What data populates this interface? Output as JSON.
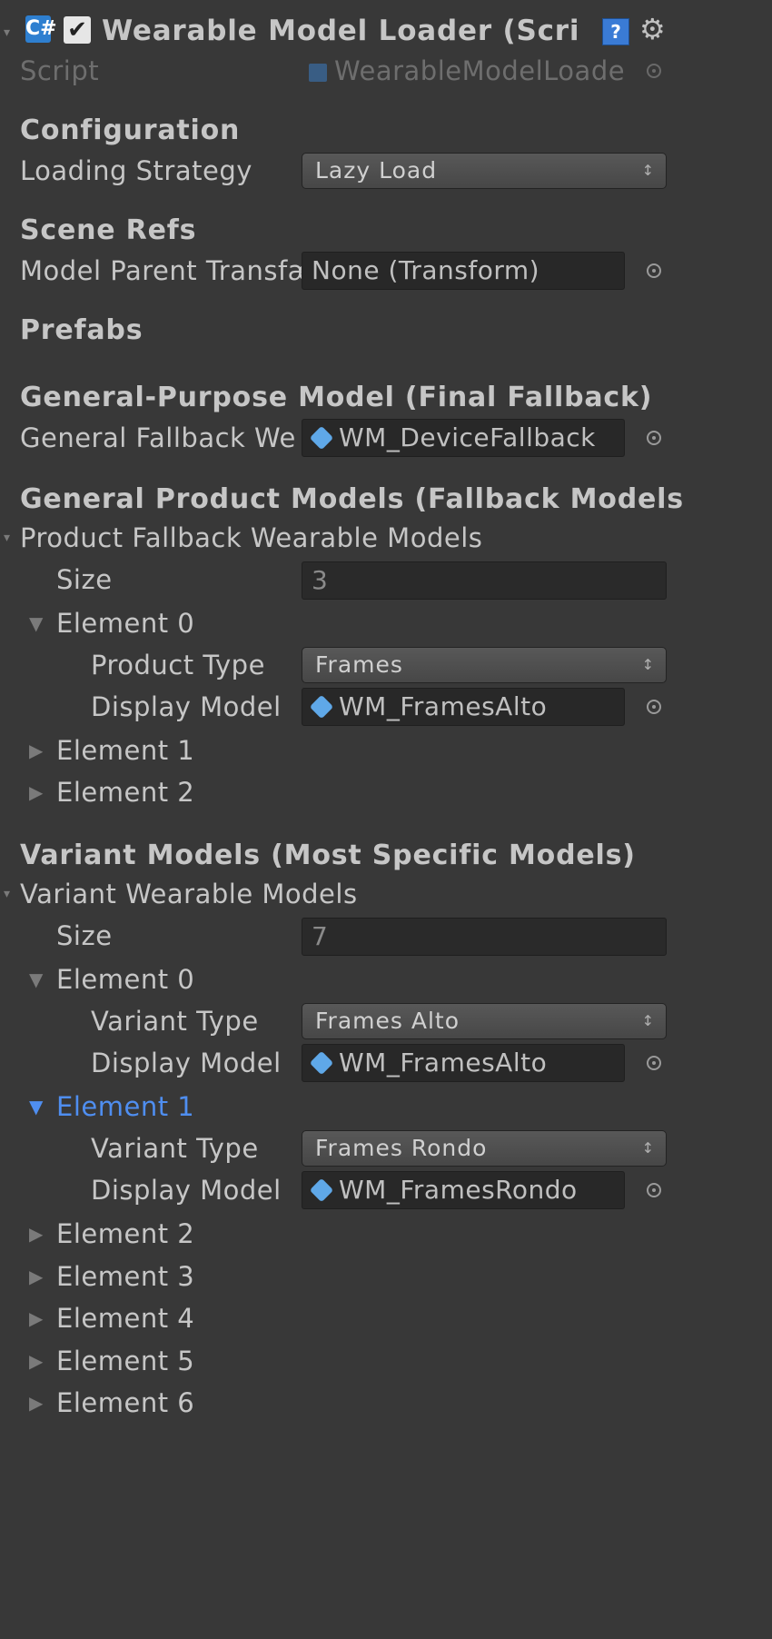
{
  "header": {
    "title": "Wearable Model Loader (Scri",
    "enabled": true,
    "script_label": "Script",
    "script_value": "WearableModelLoade"
  },
  "configuration": {
    "heading": "Configuration",
    "loading_strategy_label": "Loading Strategy",
    "loading_strategy_value": "Lazy Load"
  },
  "scene_refs": {
    "heading": "Scene Refs",
    "model_parent_label": "Model Parent Transfæ",
    "model_parent_value": "None (Transform)"
  },
  "prefabs": {
    "heading": "Prefabs"
  },
  "general_purpose": {
    "heading": "General-Purpose Model (Final Fallback)",
    "label": "General Fallback We",
    "value": "WM_DeviceFallback"
  },
  "product_models": {
    "heading": "General Product Models (Fallback Models",
    "list_label": "Product Fallback Wearable Models",
    "size_label": "Size",
    "size_value": "3",
    "elements": [
      {
        "label": "Element 0",
        "expanded": true,
        "type_label": "Product Type",
        "type_value": "Frames",
        "model_label": "Display Model",
        "model_value": "WM_FramesAlto"
      },
      {
        "label": "Element 1",
        "expanded": false
      },
      {
        "label": "Element 2",
        "expanded": false
      }
    ]
  },
  "variant_models": {
    "heading": "Variant Models (Most Specific Models)",
    "list_label": "Variant Wearable Models",
    "size_label": "Size",
    "size_value": "7",
    "elements": [
      {
        "label": "Element 0",
        "expanded": true,
        "type_label": "Variant Type",
        "type_value": "Frames Alto",
        "model_label": "Display Model",
        "model_value": "WM_FramesAlto"
      },
      {
        "label": "Element 1",
        "expanded": true,
        "selected": true,
        "type_label": "Variant Type",
        "type_value": "Frames Rondo",
        "model_label": "Display Model",
        "model_value": "WM_FramesRondo"
      },
      {
        "label": "Element 2",
        "expanded": false
      },
      {
        "label": "Element 3",
        "expanded": false
      },
      {
        "label": "Element 4",
        "expanded": false
      },
      {
        "label": "Element 5",
        "expanded": false
      },
      {
        "label": "Element 6",
        "expanded": false
      }
    ]
  },
  "glyphs": {
    "check": "✔",
    "script_icon": "C#",
    "book_icon": "?",
    "gear_icon": "⚙",
    "dropdown_arrows": "↕",
    "expanded": "▼",
    "collapsed": "▶",
    "corner": "▾"
  },
  "colors": {
    "background": "#383838",
    "text": "#c6c6c6",
    "selected": "#4f8ef0",
    "field": "#282828",
    "cube": "#5fa8e8"
  }
}
